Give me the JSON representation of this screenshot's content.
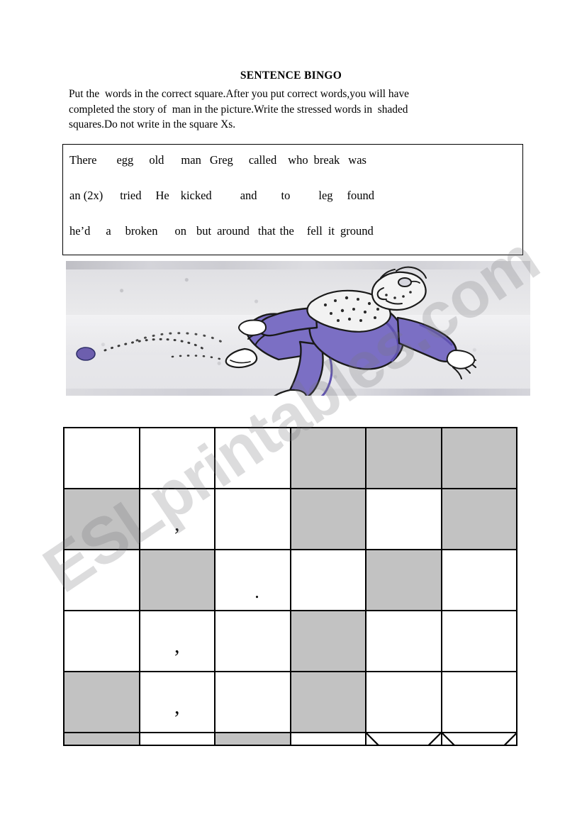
{
  "document": {
    "title": "SENTENCE BINGO",
    "instructions": [
      "Put the  words in the correct square.After you put correct words,you will have",
      "completed the story of  man in the picture.Write the stressed words in  shaded",
      "squares.Do not write in the square Xs."
    ]
  },
  "word_bank": {
    "rows": [
      [
        "There",
        "egg",
        "old",
        "man",
        "Greg",
        "called",
        "who",
        "break",
        "was"
      ],
      [
        "an (2x)",
        "tried",
        "He",
        "kicked",
        "and",
        "to",
        "leg",
        "found"
      ],
      [
        "he’d",
        "a",
        "broken",
        "on",
        "but",
        "around",
        "that",
        "the",
        "fell",
        "it",
        "ground"
      ]
    ],
    "row_gaps": [
      [
        28,
        22,
        24,
        12,
        22,
        16,
        8,
        12
      ],
      [
        24,
        20,
        16,
        40,
        34,
        40,
        20
      ],
      [
        22,
        20,
        24,
        14,
        8,
        12,
        6,
        18,
        8,
        8
      ]
    ]
  },
  "picture": {
    "alt": "cartoon of an old bearded man in a purple suit falling after kicking an egg on the ground",
    "colors": {
      "suit": "#7b6fc4",
      "suit_shadow": "#5f51b0",
      "background": "#e4e4e8",
      "egg": "#6d5fae",
      "outline": "#1a1a1a"
    }
  },
  "bingo_grid": {
    "columns": 6,
    "rows": 6,
    "shaded_color": "#c2c2c2",
    "empty_color": "#ffffff",
    "cells": [
      [
        {
          "shade": "white",
          "mark": ""
        },
        {
          "shade": "white",
          "mark": ""
        },
        {
          "shade": "white",
          "mark": ""
        },
        {
          "shade": "shaded",
          "mark": ""
        },
        {
          "shade": "shaded",
          "mark": ""
        },
        {
          "shade": "shaded",
          "mark": ""
        }
      ],
      [
        {
          "shade": "shaded",
          "mark": ""
        },
        {
          "shade": "white",
          "mark": ","
        },
        {
          "shade": "white",
          "mark": ""
        },
        {
          "shade": "shaded",
          "mark": ""
        },
        {
          "shade": "white",
          "mark": ""
        },
        {
          "shade": "shaded",
          "mark": ""
        }
      ],
      [
        {
          "shade": "white",
          "mark": ""
        },
        {
          "shade": "shaded",
          "mark": ""
        },
        {
          "shade": "white",
          "mark": "."
        },
        {
          "shade": "white",
          "mark": ""
        },
        {
          "shade": "shaded",
          "mark": ""
        },
        {
          "shade": "white",
          "mark": ""
        }
      ],
      [
        {
          "shade": "white",
          "mark": ""
        },
        {
          "shade": "white",
          "mark": ","
        },
        {
          "shade": "white",
          "mark": ""
        },
        {
          "shade": "shaded",
          "mark": ""
        },
        {
          "shade": "white",
          "mark": ""
        },
        {
          "shade": "white",
          "mark": ""
        }
      ],
      [
        {
          "shade": "shaded",
          "mark": ""
        },
        {
          "shade": "white",
          "mark": ","
        },
        {
          "shade": "white",
          "mark": ""
        },
        {
          "shade": "shaded",
          "mark": ""
        },
        {
          "shade": "white",
          "mark": ""
        },
        {
          "shade": "white",
          "mark": ""
        }
      ],
      [
        {
          "shade": "shaded",
          "mark": ""
        },
        {
          "shade": "white",
          "mark": ""
        },
        {
          "shade": "shaded",
          "mark": ""
        },
        {
          "shade": "white",
          "mark": ""
        },
        {
          "shade": "white",
          "mark": "",
          "crossed": true
        },
        {
          "shade": "white",
          "mark": "",
          "crossed": true
        }
      ]
    ]
  },
  "watermark": {
    "text": "ESLprintables.com",
    "color": "#78787d"
  }
}
